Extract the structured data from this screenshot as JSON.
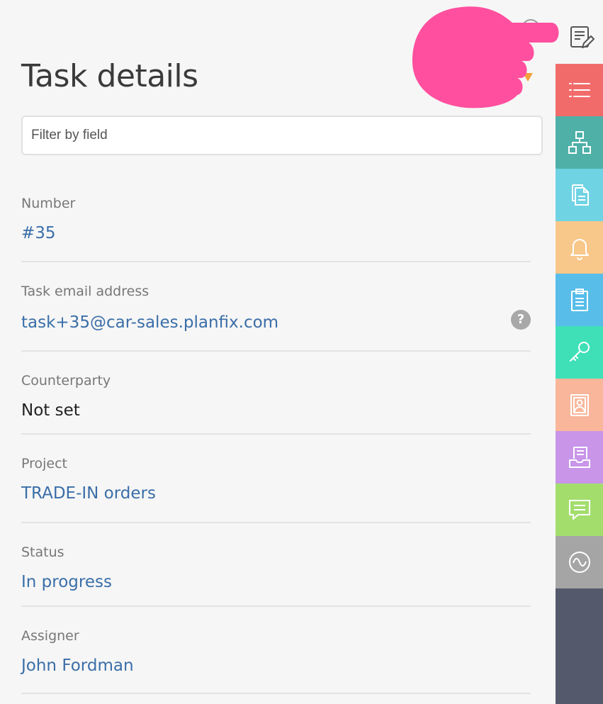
{
  "panel": {
    "title": "Task details",
    "filter_placeholder": "Filter by field"
  },
  "fields": [
    {
      "label": "Number",
      "value": "#35"
    },
    {
      "label": "Task email address",
      "value": "task+35@car-sales.planfix.com"
    },
    {
      "label": "Counterparty",
      "value": "Not set"
    },
    {
      "label": "Project",
      "value": "TRADE-IN orders"
    },
    {
      "label": "Status",
      "value": "In progress"
    },
    {
      "label": "Assigner",
      "value": "John Fordman"
    }
  ],
  "help_glyph": "?",
  "rail": {
    "tabs": [
      {
        "icon": "list-icon",
        "color": "#f26b6b"
      },
      {
        "icon": "hierarchy-icon",
        "color": "#4eb0a7"
      },
      {
        "icon": "documents-icon",
        "color": "#6fd3e3"
      },
      {
        "icon": "bell-icon",
        "color": "#f8c78a"
      },
      {
        "icon": "clipboard-icon",
        "color": "#58bde9"
      },
      {
        "icon": "key-icon",
        "color": "#3fe0b8"
      },
      {
        "icon": "contact-card-icon",
        "color": "#f9b69a"
      },
      {
        "icon": "inbox-icon",
        "color": "#c895e9"
      },
      {
        "icon": "chat-icon",
        "color": "#a3de6d"
      },
      {
        "icon": "activity-icon",
        "color": "#a5a5a5"
      }
    ],
    "base_color": "#545a6b"
  },
  "overlay": {
    "hand_color": "#ff4f9e"
  }
}
